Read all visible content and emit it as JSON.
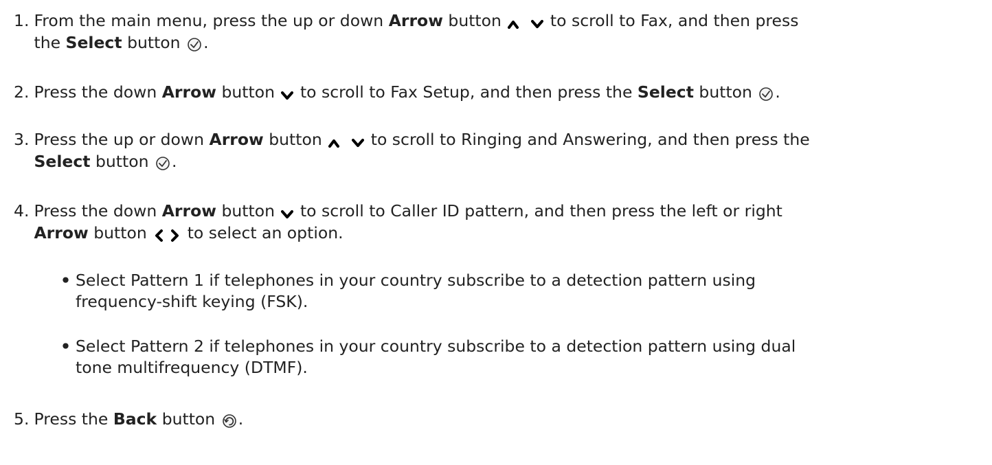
{
  "steps": [
    {
      "number": "1.",
      "l1_a": "From the main menu, press the up or down",
      "l1_b": "Arrow",
      "l1_c": "button",
      "l1_d": "to scroll to Fax, and then press",
      "l2_a": "the",
      "l2_b": "Select",
      "l2_c": "button",
      "l2_d": "."
    },
    {
      "number": "2.",
      "l1_a": "Press the down",
      "l1_b": "Arrow",
      "l1_c": "button",
      "l1_d": "to scroll to Fax Setup, and then press the",
      "l1_e": "Select",
      "l1_f": "button",
      "l1_g": "."
    },
    {
      "number": "3.",
      "l1_a": "Press the up or down",
      "l1_b": "Arrow",
      "l1_c": "button",
      "l1_d": "to scroll to Ringing and Answering, and then press the",
      "l2_a": "Select",
      "l2_b": "button",
      "l2_c": "."
    },
    {
      "number": "4.",
      "l1_a": "Press the down",
      "l1_b": "Arrow",
      "l1_c": "button",
      "l1_d": "to scroll to Caller ID pattern, and then press the left or right",
      "l2_a": "Arrow",
      "l2_b": "button",
      "l2_c": "to select an option."
    },
    {
      "number": "5.",
      "l1_a": "Press the",
      "l1_b": "Back",
      "l1_c": "button",
      "l1_d": "."
    }
  ],
  "bullets": [
    {
      "line1": "Select Pattern 1 if telephones in your country subscribe to a detection pattern using",
      "line2": "frequency-shift keying (FSK)."
    },
    {
      "line1": "Select Pattern 2 if telephones in your country subscribe to a detection pattern using dual",
      "line2": "tone multifrequency (DTMF)."
    }
  ],
  "icons": {
    "up": "arrow-up-icon",
    "down": "arrow-down-icon",
    "left": "arrow-left-icon",
    "right": "arrow-right-icon",
    "select": "select-check-icon",
    "back": "back-icon"
  }
}
